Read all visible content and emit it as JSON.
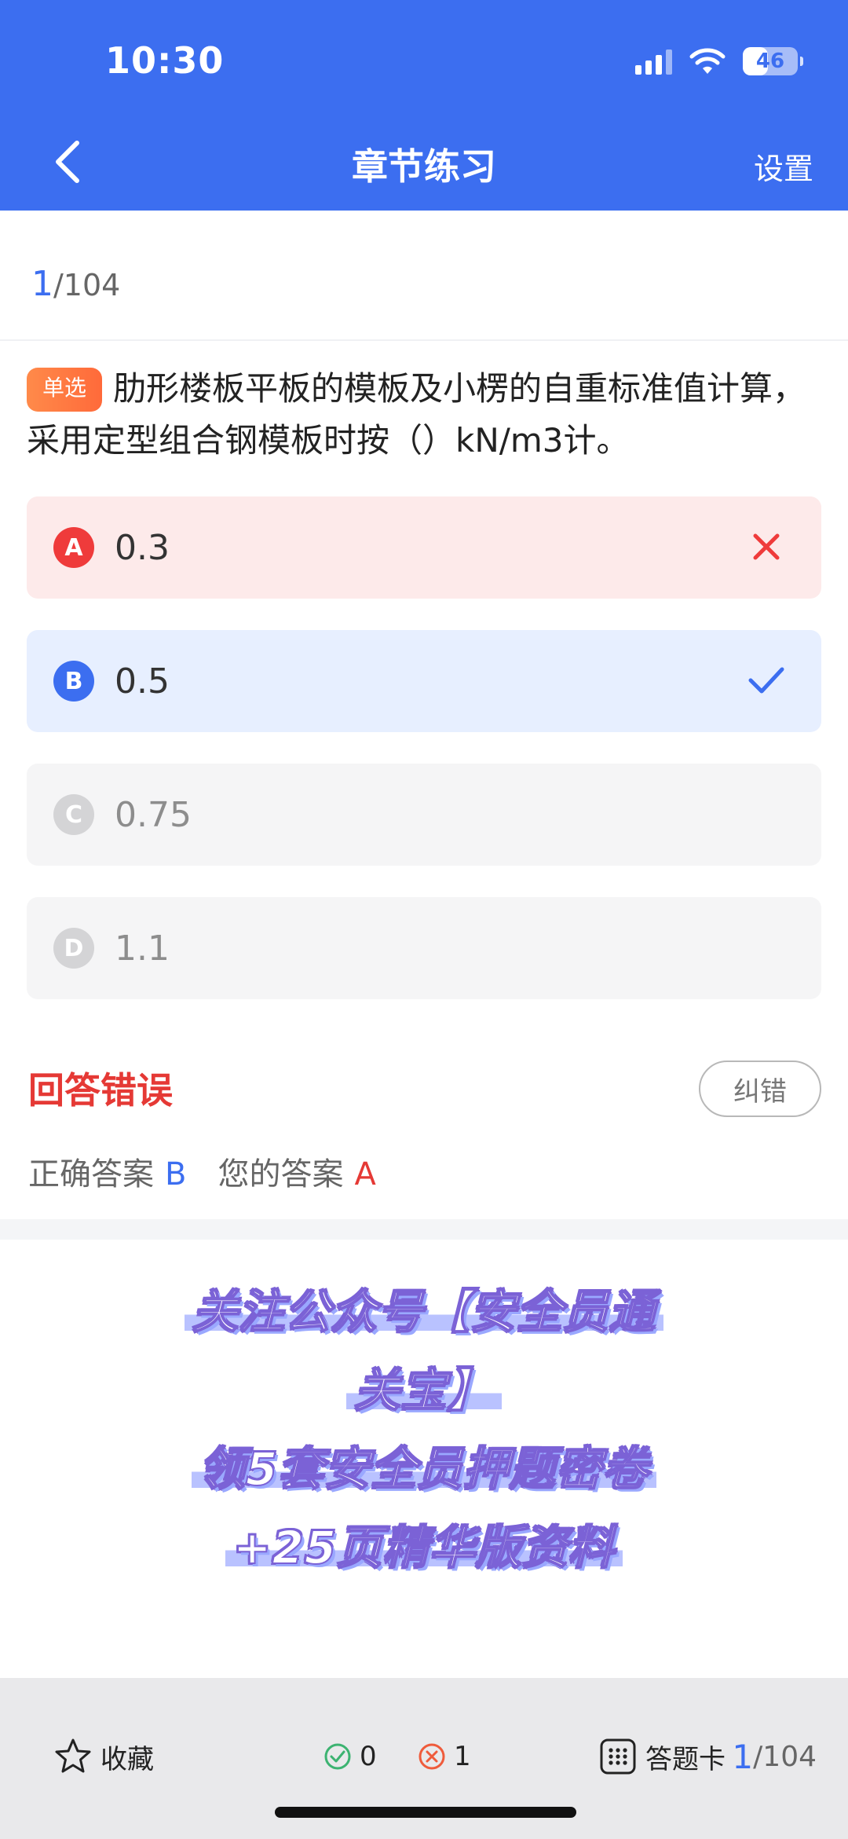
{
  "status_bar": {
    "time": "10:30",
    "battery": "46"
  },
  "nav": {
    "title": "章节练习",
    "settings": "设置"
  },
  "progress": {
    "current": "1",
    "total": "/104"
  },
  "question": {
    "type_tag": "单选",
    "text": "肋形楼板平板的模板及小楞的自重标准值计算，采用定型组合钢模板时按（）kN/m3计。"
  },
  "options": [
    {
      "letter": "A",
      "value": "0.3",
      "state": "wrong"
    },
    {
      "letter": "B",
      "value": "0.5",
      "state": "correct"
    },
    {
      "letter": "C",
      "value": "0.75",
      "state": "normal"
    },
    {
      "letter": "D",
      "value": "1.1",
      "state": "normal"
    }
  ],
  "result": {
    "title": "回答错误",
    "report_button": "纠错",
    "correct_label": "正确答案",
    "correct_value": "B",
    "your_label": "您的答案",
    "your_value": "A"
  },
  "promo": {
    "lines": [
      "关注公众号【安全员通",
      "关宝】",
      "领5套安全员押题密卷",
      "+25页精华版资料"
    ]
  },
  "bottom_bar": {
    "favorite": "收藏",
    "right_count": "0",
    "wrong_count": "1",
    "answer_card": "答题卡",
    "progress_current": "1",
    "progress_total": "/104"
  },
  "colors": {
    "primary": "#3c6ef0",
    "error": "#e53935",
    "tag": "#ff7a40"
  }
}
